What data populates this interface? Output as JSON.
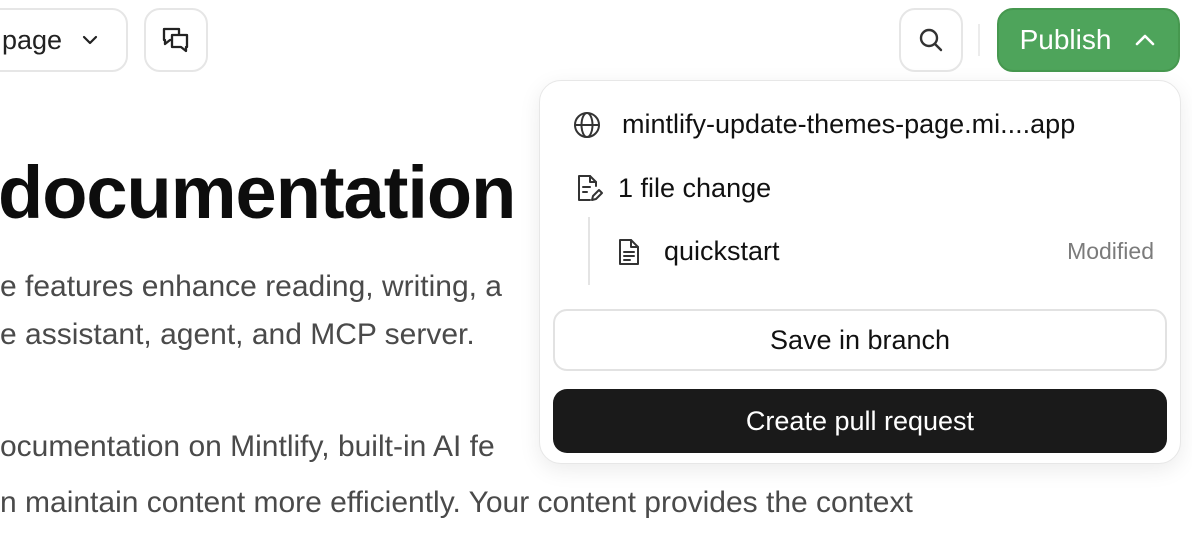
{
  "toolbar": {
    "page_selector_label": "page",
    "publish_label": "Publish",
    "publish_color": "#4ea45b"
  },
  "content": {
    "heading": "documentation",
    "intro_line_1": "e features enhance reading, writing, a",
    "intro_line_2": "e assistant, agent, and MCP server.",
    "body_line_1": "ocumentation on Mintlify, built-in AI fe",
    "body_line_2": "n maintain content more efficiently. Your content provides the context"
  },
  "publish_dropdown": {
    "domain": "mintlify-update-themes-page.mi....app",
    "changes_summary": "1 file change",
    "files": [
      {
        "name": "quickstart",
        "status": "Modified"
      }
    ],
    "save_label": "Save in branch",
    "create_pr_label": "Create pull request"
  },
  "icons": [
    "chevron-down-icon",
    "comments-icon",
    "search-icon",
    "chevron-up-icon",
    "globe-icon",
    "file-edit-icon",
    "file-icon"
  ]
}
